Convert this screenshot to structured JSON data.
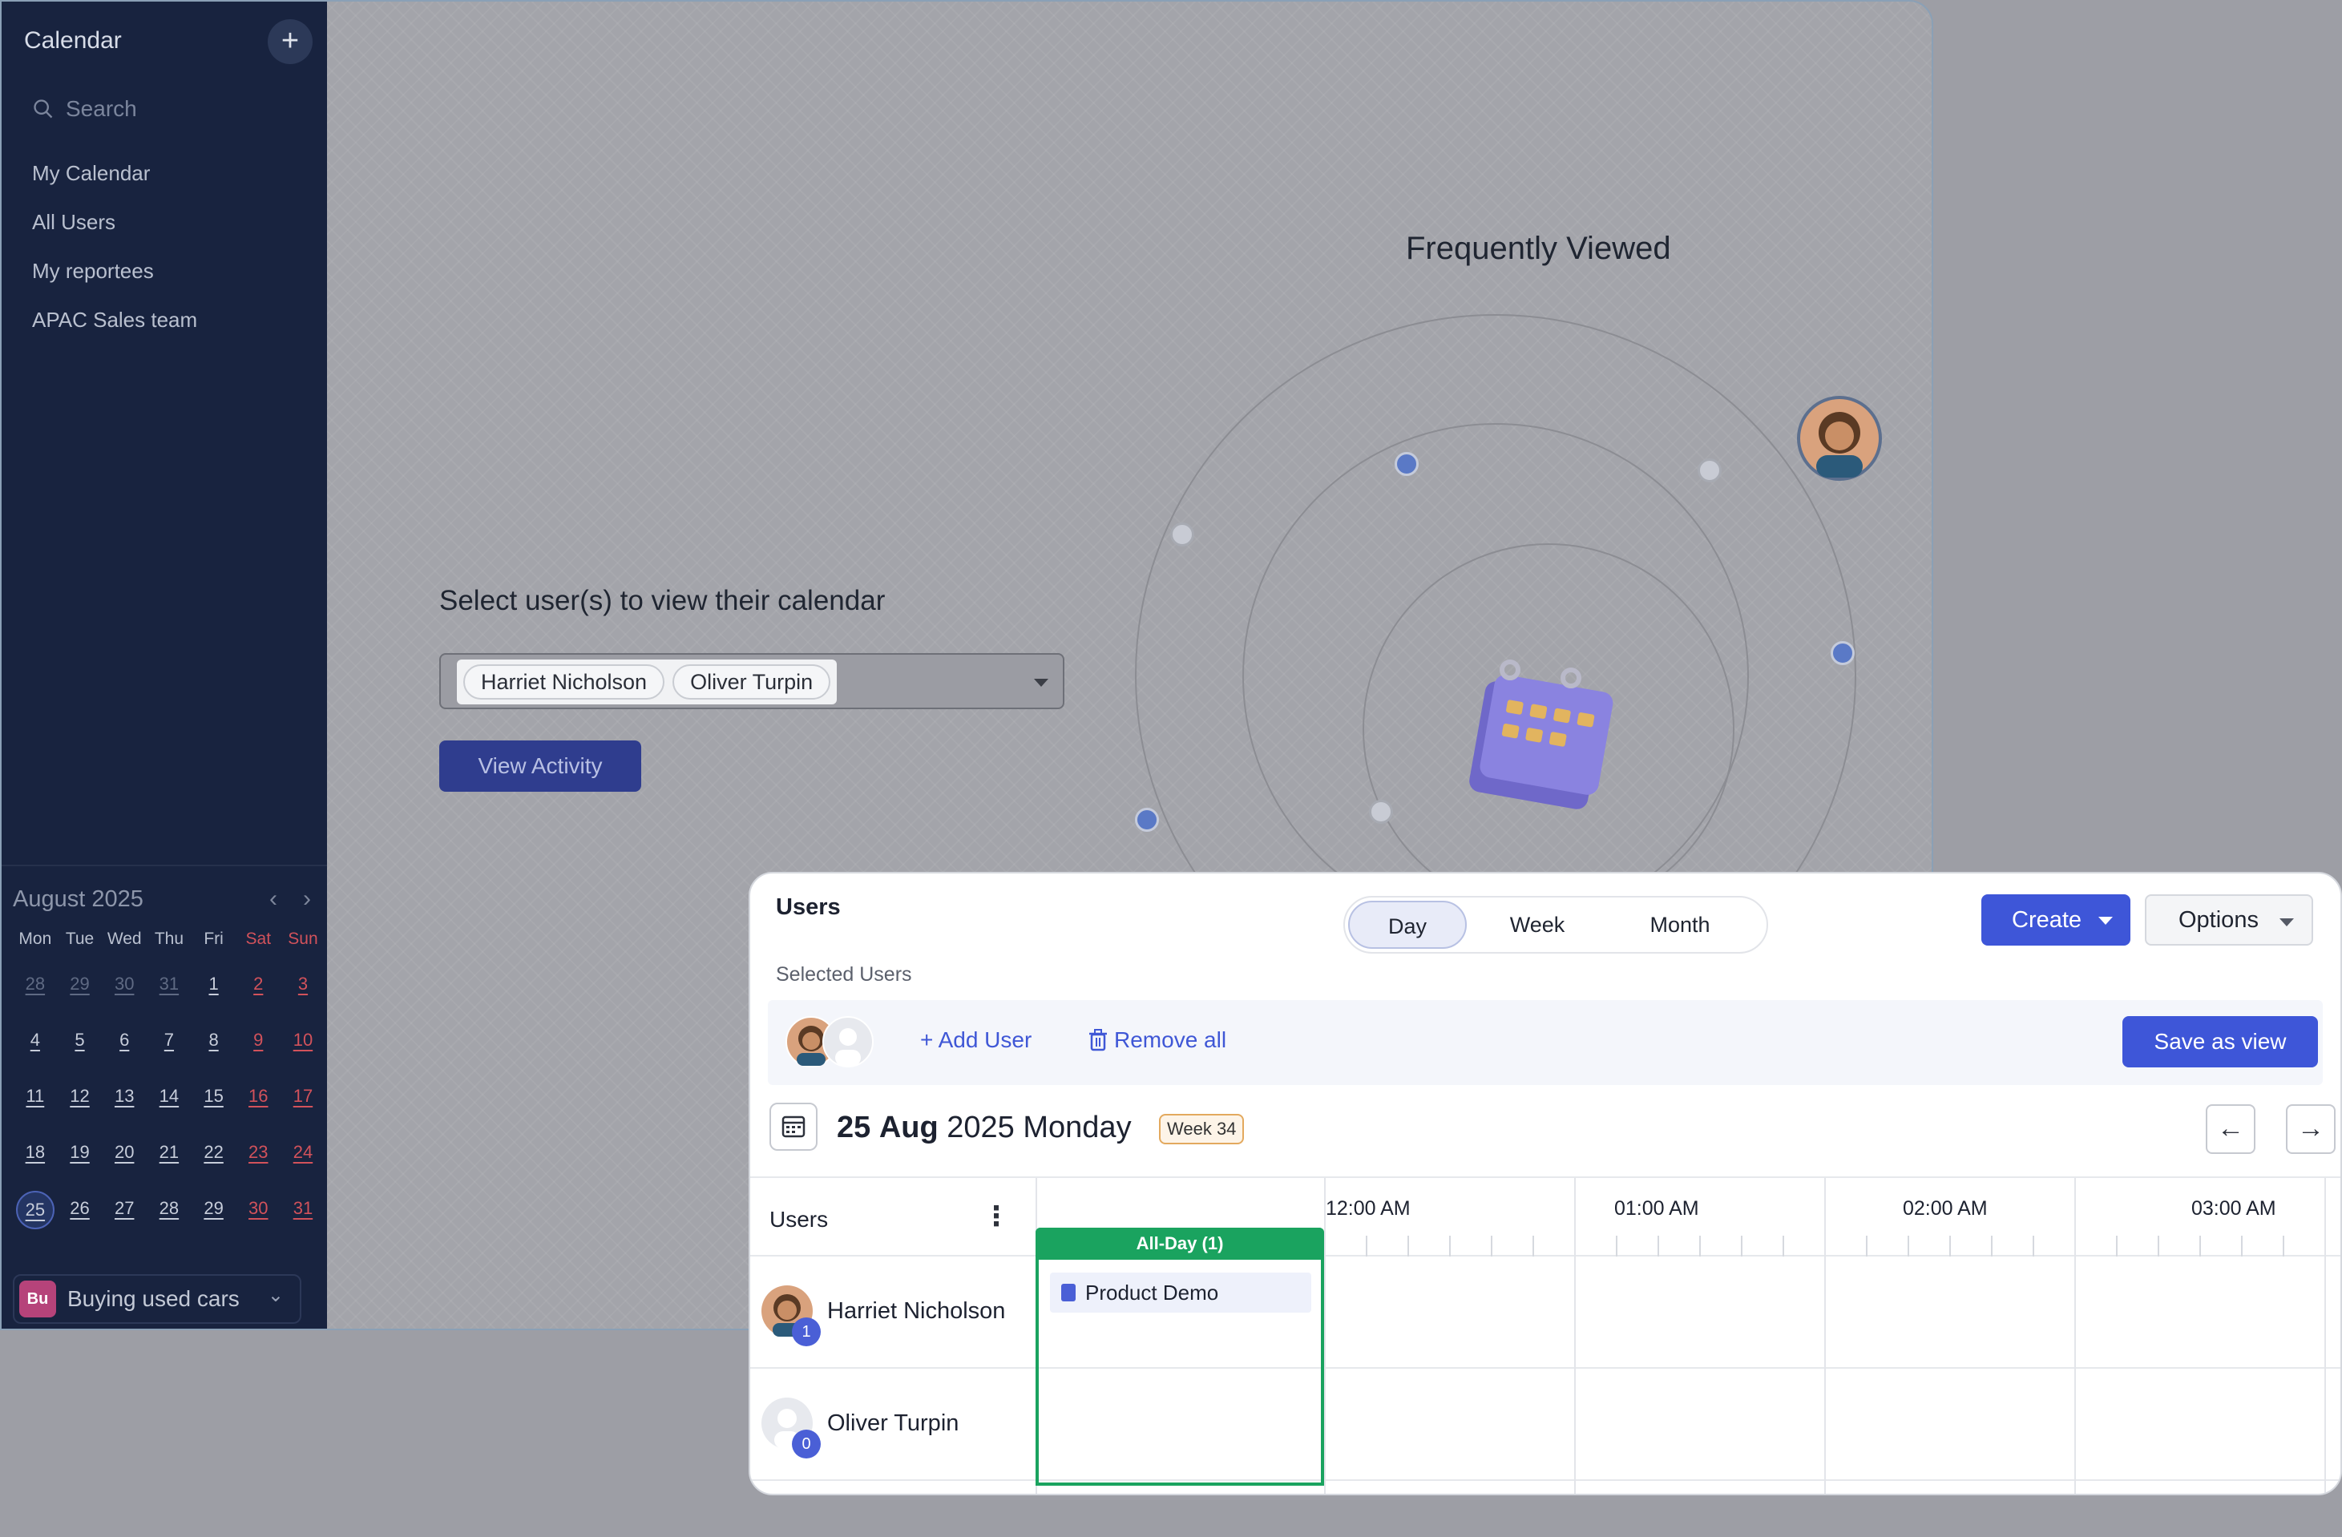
{
  "sidebar": {
    "title": "Calendar",
    "search_placeholder": "Search",
    "nav": [
      "My Calendar",
      "All Users",
      "My reportees",
      "APAC Sales team"
    ],
    "mini_calendar": {
      "month_label": "August 2025",
      "weekdays": [
        "Mon",
        "Tue",
        "Wed",
        "Thu",
        "Fri",
        "Sat",
        "Sun"
      ],
      "weeks": [
        [
          "28",
          "29",
          "30",
          "31",
          "1",
          "2",
          "3"
        ],
        [
          "4",
          "5",
          "6",
          "7",
          "8",
          "9",
          "10"
        ],
        [
          "11",
          "12",
          "13",
          "14",
          "15",
          "16",
          "17"
        ],
        [
          "18",
          "19",
          "20",
          "21",
          "22",
          "23",
          "24"
        ],
        [
          "25",
          "26",
          "27",
          "28",
          "29",
          "30",
          "31"
        ]
      ],
      "selected_day": "25"
    },
    "footer": {
      "badge": "Bu",
      "label": "Buying used cars"
    }
  },
  "main": {
    "select_label": "Select user(s) to view their calendar",
    "selected_chips": [
      "Harriet Nicholson",
      "Oliver Turpin"
    ],
    "view_activity_label": "View Activity",
    "frequently_viewed_title": "Frequently Viewed"
  },
  "panel": {
    "title": "Users",
    "views": [
      "Day",
      "Week",
      "Month"
    ],
    "active_view": "Day",
    "create_label": "Create",
    "options_label": "Options",
    "selected_users_label": "Selected Users",
    "add_user_label": "+ Add User",
    "remove_all_label": "Remove all",
    "save_view_label": "Save as view",
    "date": {
      "day": "25",
      "month": "Aug",
      "rest": "2025 Monday",
      "week": "Week 34"
    },
    "grid": {
      "users_header": "Users",
      "times": [
        "12:00 AM",
        "01:00 AM",
        "02:00 AM",
        "03:00 AM"
      ],
      "allday_label": "All-Day (1)",
      "event": "Product Demo",
      "users": [
        {
          "name": "Harriet Nicholson",
          "count": "1"
        },
        {
          "name": "Oliver Turpin",
          "count": "0"
        }
      ]
    }
  },
  "colors": {
    "accent": "#3e56d8",
    "allday": "#1aa35f",
    "sidebar": "#18233f",
    "weekend": "#d2525b"
  }
}
